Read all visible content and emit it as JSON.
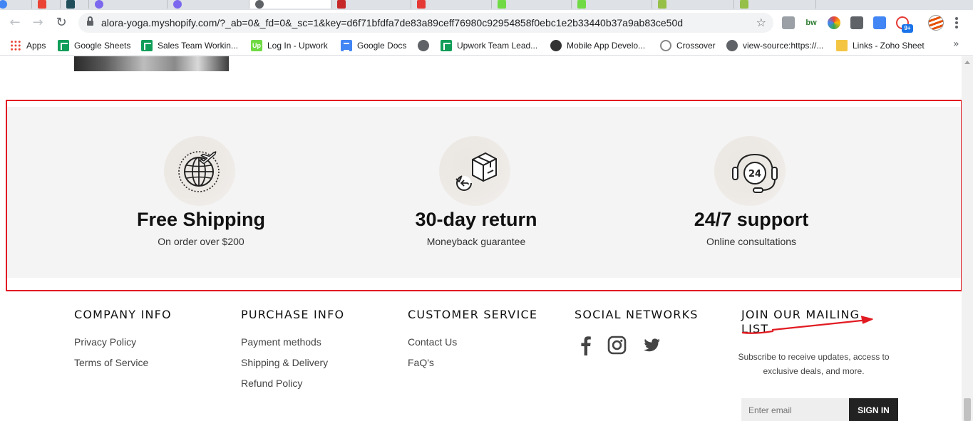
{
  "browser": {
    "url": "alora-yoga.myshopify.com/?_ab=0&_fd=0&_sc=1&key=d6f71bfdfa7de83a89ceff76980c92954858f0ebc1e2b33440b37a9ab83ce50d",
    "bookmarks": [
      {
        "label": "Apps"
      },
      {
        "label": "Google Sheets"
      },
      {
        "label": "Sales Team Workin..."
      },
      {
        "label": "Log In - Upwork"
      },
      {
        "label": "Google Docs"
      },
      {
        "label": ""
      },
      {
        "label": "Upwork Team Lead..."
      },
      {
        "label": "Mobile App Develo..."
      },
      {
        "label": "Crossover"
      },
      {
        "label": "view-source:https://..."
      },
      {
        "label": "Links - Zoho Sheet"
      }
    ],
    "extensions": {
      "bw_label": "bw",
      "badge": "9+"
    }
  },
  "features": [
    {
      "title": "Free Shipping",
      "subtitle": "On order over $200",
      "icon": "globe-plane-icon"
    },
    {
      "title": "30-day return",
      "subtitle": "Moneyback guarantee",
      "icon": "box-return-icon"
    },
    {
      "title": "24/7 support",
      "subtitle": "Online consultations",
      "icon": "headset-24-icon"
    }
  ],
  "footer": {
    "company": {
      "heading": "COMPANY INFO",
      "links": [
        "Privacy Policy",
        "Terms of Service"
      ]
    },
    "purchase": {
      "heading": "PURCHASE INFO",
      "links": [
        "Payment methods",
        "Shipping & Delivery",
        "Refund Policy"
      ]
    },
    "service": {
      "heading": "CUSTOMER SERVICE",
      "links": [
        "Contact Us",
        "FaQ's"
      ]
    },
    "social": {
      "heading": "SOCIAL NETWORKS",
      "icons": [
        "facebook-icon",
        "instagram-icon",
        "twitter-icon"
      ]
    },
    "mailing": {
      "heading": "JOIN OUR MAILING LIST",
      "subtitle": "Subscribe to receive updates, access to exclusive deals, and more.",
      "email_placeholder": "Enter email",
      "button_label": "SIGN IN"
    }
  },
  "colors": {
    "annotation_red": "#e11b22",
    "feature_bg": "#f4f4f4",
    "button_dark": "#222222"
  }
}
